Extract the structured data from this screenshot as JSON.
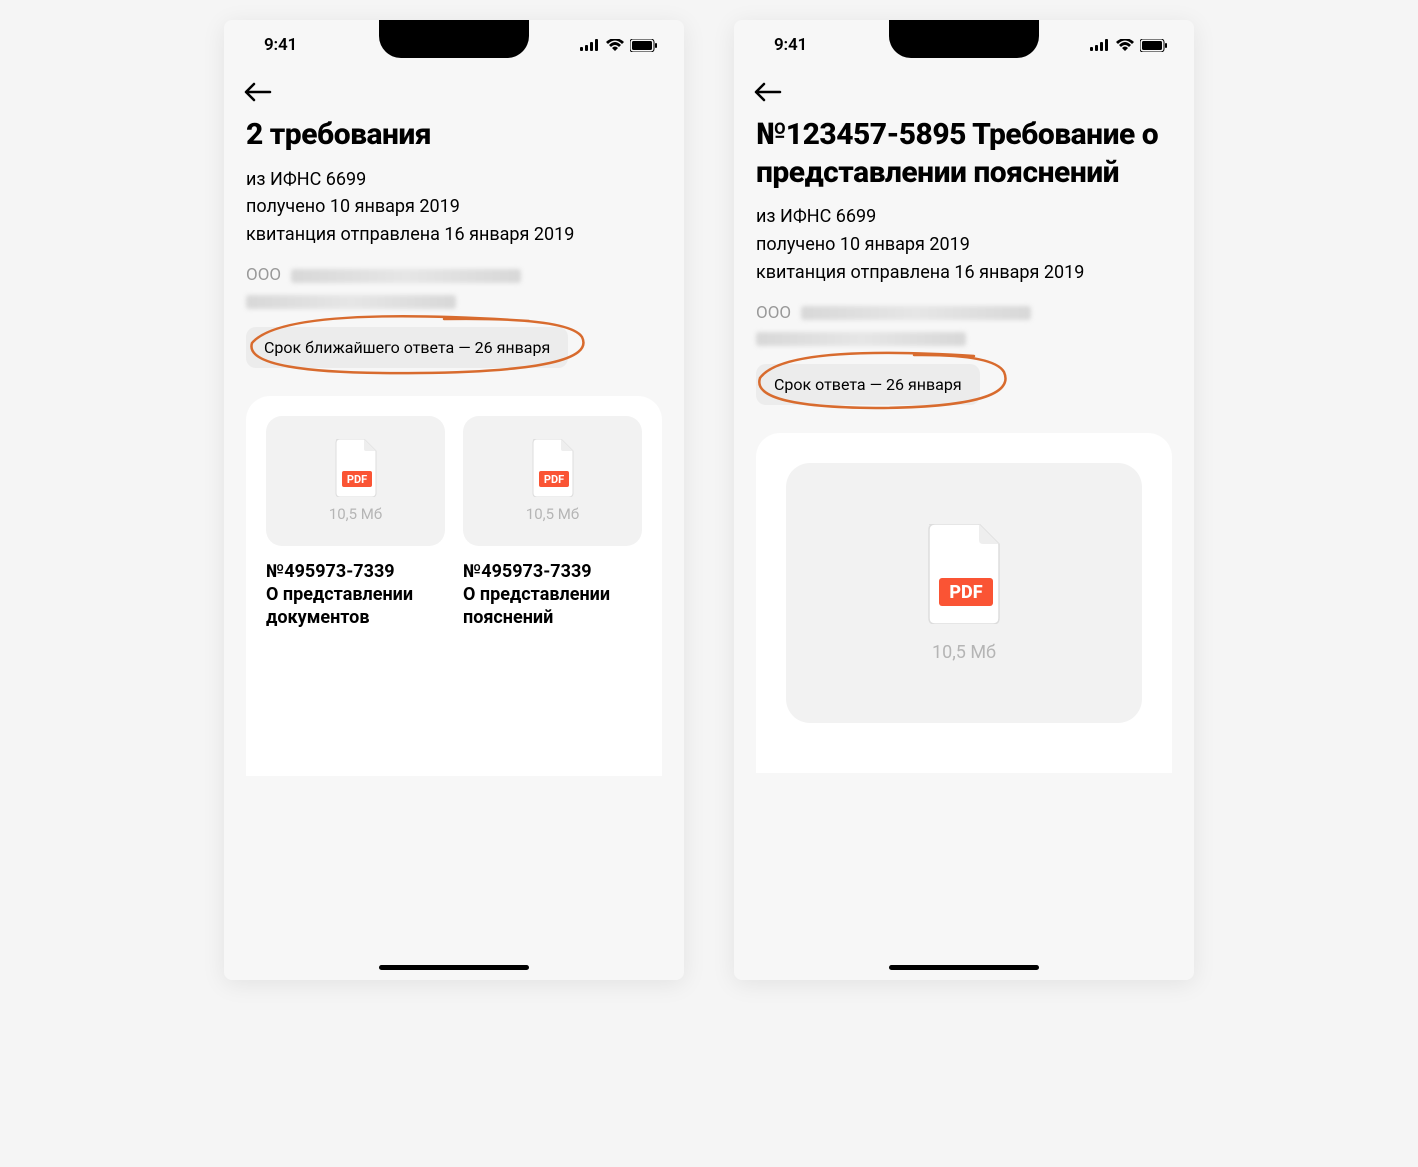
{
  "status": {
    "time": "9:41"
  },
  "screen1": {
    "title": "2 требования",
    "meta1": "из ИФНС 6699",
    "meta2": "получено 10 января 2019",
    "meta3": "квитанция отправлена 16 января 2019",
    "orgPrefix": "ООО",
    "deadline": "Срок ближайшего ответа — 26 января",
    "docs": [
      {
        "size": "10,5 Мб",
        "number": "№495973-7339",
        "desc": "О представлении документов"
      },
      {
        "size": "10,5 Мб",
        "number": "№495973-7339",
        "desc": "О представлении пояснений"
      }
    ]
  },
  "screen2": {
    "title": "№123457-5895 Требование о представлении пояснений",
    "meta1": "из ИФНС 6699",
    "meta2": "получено 10 января 2019",
    "meta3": "квитанция отправлена 16 января 2019",
    "orgPrefix": "ООО",
    "deadline": "Срок ответа — 26 января",
    "doc": {
      "size": "10,5 Мб",
      "label": "PDF"
    }
  },
  "icons": {
    "pdfLabel": "PDF"
  },
  "colors": {
    "accent": "#fa5434",
    "highlight": "#d86b2e"
  }
}
